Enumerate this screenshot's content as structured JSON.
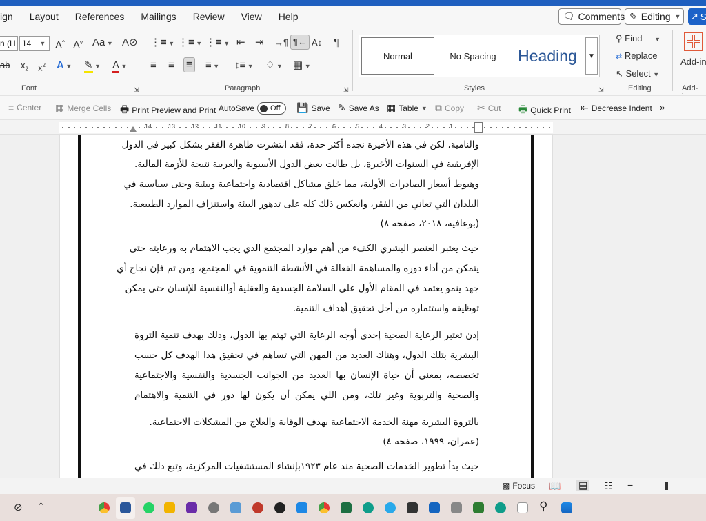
{
  "menu": {
    "items": [
      "ign",
      "Layout",
      "References",
      "Mailings",
      "Review",
      "View",
      "Help"
    ],
    "comments_label": "Comments",
    "editing_label": "Editing",
    "share_label": "S"
  },
  "ribbon": {
    "font": {
      "font_name": "n (H",
      "font_size": "14",
      "label": "Font"
    },
    "paragraph": {
      "label": "Paragraph"
    },
    "styles": {
      "label": "Styles",
      "items": [
        "Normal",
        "No Spacing",
        "Heading"
      ]
    },
    "editing": {
      "label": "Editing",
      "find": "Find",
      "replace": "Replace",
      "select": "Select"
    },
    "addins": {
      "button": "Add-in",
      "label": "Add-ins"
    }
  },
  "qat": {
    "center": "Center",
    "merge_cells": "Merge Cells",
    "print_preview": "Print Preview and Print",
    "autosave": "AutoSave",
    "autosave_state": "Off",
    "save": "Save",
    "save_as": "Save As",
    "table": "Table",
    "copy": "Copy",
    "cut": "Cut",
    "quick_print": "Quick Print",
    "decrease_indent": "Decrease Indent",
    "more": "»"
  },
  "ruler": {
    "numbers": [
      "14",
      "13",
      "12",
      "11",
      "10",
      "9",
      "8",
      "7",
      "6",
      "5",
      "4",
      "3",
      "2",
      "1"
    ]
  },
  "document": {
    "lines": [
      "والنامية، لكن في هذه الأخيرة نجده أكثر حدة، فقد انتشرت ظاهرة الفقر بشكل كبير في الدول",
      "الإفريقية في السنوات الأخيرة، بل طالت بعض الدول الأسيوية والعربية نتيجة للأزمة المالية.",
      "وهبوط أسعار الصادرات الأولية، مما خلق مشاكل اقتصادية واجتماعية وبيئية وحتى سياسية في",
      "البلدان التي تعاني من الفقر، وانعكس ذلك كله على تدهور البيئة واستنزاف الموارد الطبيعية.",
      "(بوعافية، ٢٠١٨، صفحة ٨)",
      "حيث يعتبر العنصر البشري الكفء من أهم موارد المجتمع الذي يجب الاهتمام به ورعايته حتى",
      "يتمكن من أداء دوره والمساهمة الفعالة في الأنشطة التنموية في المجتمع، ومن ثم فإن نجاح أي",
      "جهد ينمو يعتمد في المقام الأول على السلامة الجسدية والعقلية أوالنفسية للإنسان حتى يمكن",
      "توظيفه واستثماره من أجل تحقيق أهداف التنمية.",
      "إذن تعتبر الرعاية الصحية إحدى أوجه الرعاية التي تهتم بها الدول، وذلك بهدف تنمية الثروة",
      "البشرية بتلك الدول، وهناك العديد من المهن التي تساهم في تحقيق هذا الهدف كل حسب",
      "تخصصه، بمعنى أن حياة الإنسان بها العديد من الجوانب الجسدية والنفسية والاجتماعية",
      "والصحية والتربوية وغير تلك، ومن اللي يمكن أن يكون لها دور في التنمية والاهتمام",
      "بالثروة البشرية مهنة الخدمة الاجتماعية بهدف الوقاية والعلاج من المشكلات الاجتماعية.",
      "(عمران، ١٩٩٩، صفحة ٤)",
      "حيث بدأ تطوير الخدمات الصحية منذ عام ١٩٢٣بإنشاء المستشفيات المركزية، وتبع ذلك في"
    ]
  },
  "status": {
    "focus": "Focus"
  }
}
